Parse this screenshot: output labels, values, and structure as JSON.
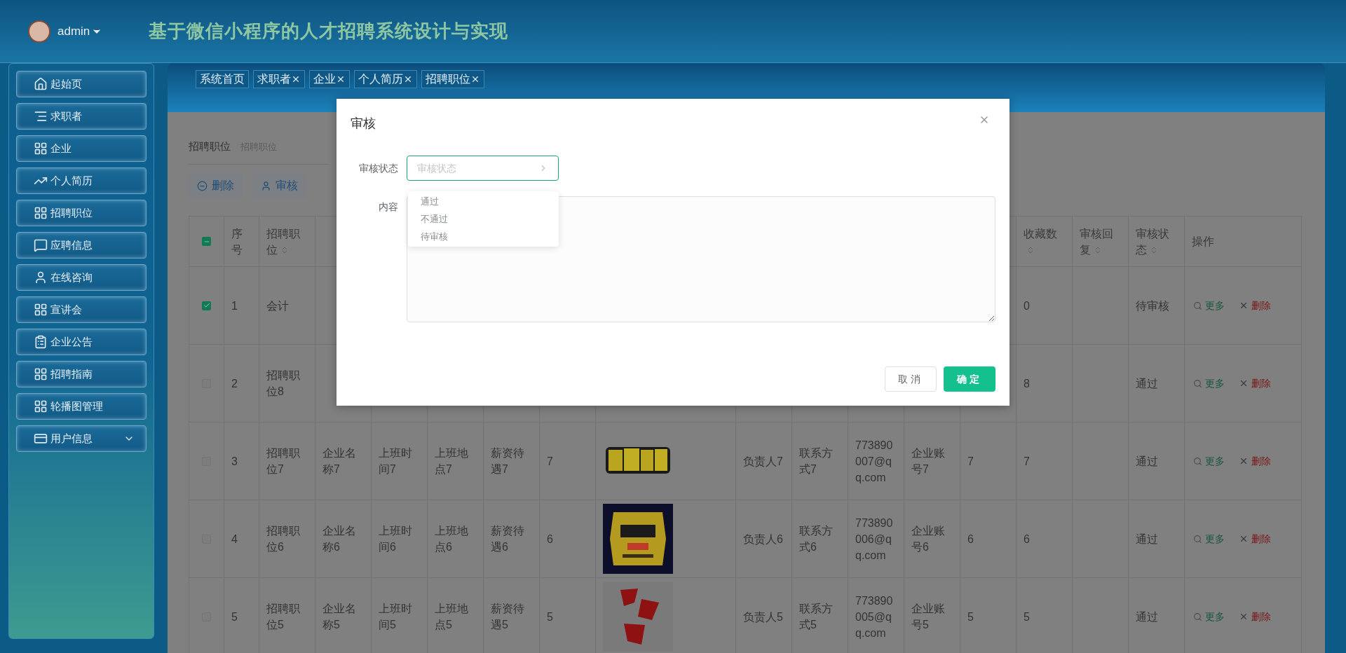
{
  "header": {
    "user": "admin",
    "title": "基于微信小程序的人才招聘系统设计与实现"
  },
  "sidebar": {
    "items": [
      {
        "label": "起始页",
        "kind": "link"
      },
      {
        "label": "求职者",
        "kind": "link"
      },
      {
        "label": "企业",
        "kind": "link"
      },
      {
        "label": "个人简历",
        "kind": "link"
      },
      {
        "label": "招聘职位",
        "kind": "link"
      },
      {
        "label": "应聘信息",
        "kind": "link"
      },
      {
        "label": "在线咨询",
        "kind": "link"
      },
      {
        "label": "宣讲会",
        "kind": "link"
      },
      {
        "label": "企业公告",
        "kind": "link"
      },
      {
        "label": "招聘指南",
        "kind": "link"
      },
      {
        "label": "轮播图管理",
        "kind": "link"
      },
      {
        "label": "用户信息",
        "kind": "group"
      }
    ]
  },
  "tabs": [
    {
      "label": "系统首页",
      "closable": false
    },
    {
      "label": "求职者",
      "closable": true
    },
    {
      "label": "企业",
      "closable": true
    },
    {
      "label": "个人简历",
      "closable": true
    },
    {
      "label": "招聘职位",
      "closable": true
    }
  ],
  "search": {
    "label": "招聘职位",
    "placeholder": "招聘职位"
  },
  "actions": [
    {
      "label": "删除",
      "kind": "delete"
    },
    {
      "label": "审核",
      "kind": "review"
    }
  ],
  "table": {
    "select_all_indeterminate": true,
    "columns_left": [
      {
        "label": "序号",
        "sortable": false
      },
      {
        "label": "招聘职位",
        "sortable": true
      }
    ],
    "columns_right": [
      {
        "label": "收藏数",
        "sortable": true
      },
      {
        "label": "审核回复",
        "sortable": true
      },
      {
        "label": "审核状态",
        "sortable": true
      },
      {
        "label": "操作",
        "sortable": false
      }
    ],
    "rows": [
      {
        "selected": true,
        "no": "1",
        "title": "会计",
        "favorites": "0",
        "status": "待审核",
        "operations": [
          {
            "label": "更多",
            "kind": "more"
          },
          {
            "label": "删除",
            "kind": "delete"
          }
        ]
      },
      {
        "selected": false,
        "no": "2",
        "title": "招聘职位8",
        "favorites": "8",
        "status": "通过",
        "operations": [
          {
            "label": "更多",
            "kind": "more"
          },
          {
            "label": "删除",
            "kind": "delete"
          }
        ]
      },
      {
        "selected": false,
        "no": "3",
        "title": "招聘职位7",
        "company": "企业名称7",
        "work_time": "上班时间7",
        "work_place": "上班地点7",
        "salary": "薪资待遇7",
        "column_8": "7",
        "image": {
          "kind": "picture"
        },
        "contact_person": "负责人7",
        "contact": "联系方式7",
        "email": "773890007@qq.com",
        "account": "企业账号7",
        "column_14": "7",
        "favorites": "7",
        "status": "通过",
        "operations": [
          {
            "label": "更多",
            "kind": "more"
          },
          {
            "label": "删除",
            "kind": "delete"
          }
        ]
      },
      {
        "selected": false,
        "no": "4",
        "title": "招聘职位6",
        "company": "企业名称6",
        "work_time": "上班时间6",
        "work_place": "上班地点6",
        "salary": "薪资待遇6",
        "column_8": "6",
        "image": {
          "kind": "picture"
        },
        "contact_person": "负责人6",
        "contact": "联系方式6",
        "email": "773890006@qq.com",
        "account": "企业账号6",
        "column_14": "6",
        "favorites": "6",
        "status": "通过",
        "operations": [
          {
            "label": "更多",
            "kind": "more"
          },
          {
            "label": "删除",
            "kind": "delete"
          }
        ]
      },
      {
        "selected": false,
        "no": "5",
        "title": "招聘职位5",
        "company": "企业名称5",
        "work_time": "上班时间5",
        "work_place": "上班地点5",
        "salary": "薪资待遇5",
        "column_8": "5",
        "image": {
          "kind": "picture"
        },
        "contact_person": "负责人5",
        "contact": "联系方式5",
        "email": "773890005@qq.com",
        "account": "企业账号5",
        "column_14": "5",
        "favorites": "5",
        "status": "通过",
        "operations": [
          {
            "label": "更多",
            "kind": "more"
          },
          {
            "label": "删除",
            "kind": "delete"
          }
        ]
      }
    ]
  },
  "dialog": {
    "title": "审核",
    "fields": [
      {
        "label": "审核状态",
        "kind": "select",
        "placeholder": "审核状态",
        "expanded": true,
        "options": [
          "通过",
          "不通过",
          "待审核"
        ]
      },
      {
        "label": "内容",
        "kind": "textarea"
      }
    ],
    "buttons": [
      {
        "label": "取消",
        "kind": "secondary"
      },
      {
        "label": "确定",
        "kind": "primary"
      }
    ]
  }
}
